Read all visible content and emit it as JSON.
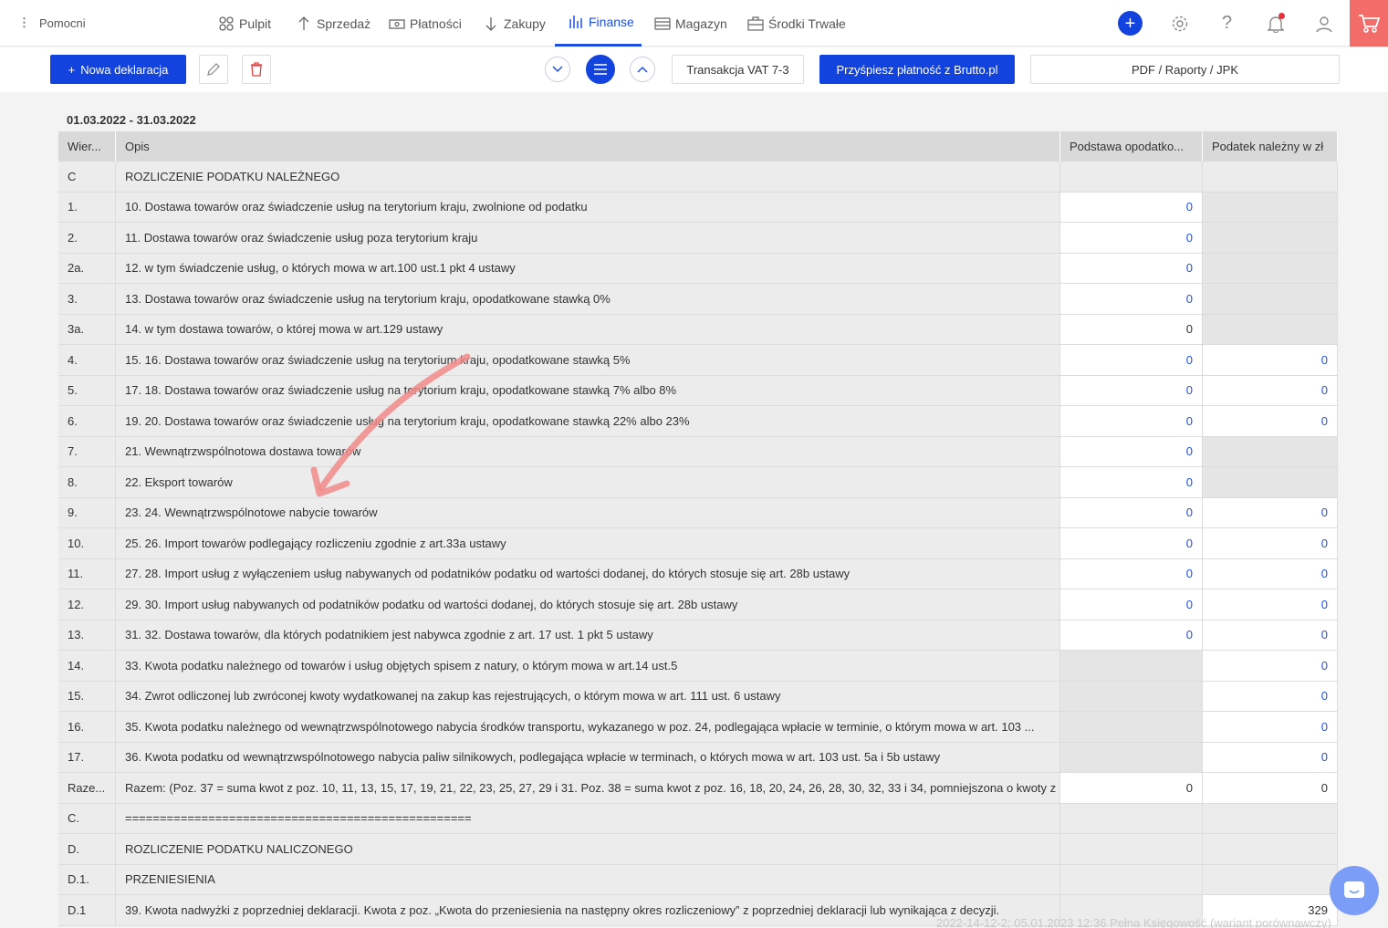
{
  "nav": {
    "helpers": "Pomocni",
    "items": [
      {
        "label": "Pulpit",
        "icon": "dashboard-icon"
      },
      {
        "label": "Sprzedaż",
        "icon": "arrow-up-icon"
      },
      {
        "label": "Płatności",
        "icon": "money-icon"
      },
      {
        "label": "Zakupy",
        "icon": "arrow-down-icon"
      },
      {
        "label": "Finanse",
        "icon": "bar-chart-icon",
        "active": true
      },
      {
        "label": "Magazyn",
        "icon": "warehouse-icon"
      },
      {
        "label": "Środki Trwałe",
        "icon": "briefcase-icon"
      }
    ]
  },
  "toolbar": {
    "new_label": "Nowa deklaracja",
    "vat_label": "Transakcja VAT 7-3",
    "brutto_label": "Przyśpiesz płatność z Brutto.pl",
    "pdf_label": "PDF / Raporty / JPK"
  },
  "period": "01.03.2022 - 31.03.2022",
  "table": {
    "headers": [
      "Wier...",
      "Opis",
      "Podstawa opodatko...",
      "Podatek należny w zł"
    ],
    "rows": [
      {
        "w": "C",
        "opis": "ROZLICZENIE PODATKU NALEŻNEGO",
        "p": "",
        "n": "",
        "pt": "g2",
        "nt": "g2"
      },
      {
        "w": "1.",
        "opis": "10. Dostawa towarów oraz świadczenie usług na terytorium kraju, zwolnione od podatku",
        "p": "0",
        "n": "",
        "pt": "wl",
        "nt": "g"
      },
      {
        "w": "2.",
        "opis": "11. Dostawa towarów oraz świadczenie usług poza terytorium kraju",
        "p": "0",
        "n": "",
        "pt": "wl",
        "nt": "g"
      },
      {
        "w": "2a.",
        "opis": "12. w tym świadczenie usług, o których mowa w art.100 ust.1 pkt 4 ustawy",
        "p": "0",
        "n": "",
        "pt": "wl",
        "nt": "g"
      },
      {
        "w": "3.",
        "opis": "13. Dostawa towarów oraz świadczenie usług na terytorium kraju, opodatkowane stawką 0%",
        "p": "0",
        "n": "",
        "pt": "wl",
        "nt": "g"
      },
      {
        "w": "3a.",
        "opis": "14. w tym dostawa towarów, o której mowa w art.129 ustawy",
        "p": "0",
        "n": "",
        "pt": "wp",
        "nt": "g"
      },
      {
        "w": "4.",
        "opis": "15. 16. Dostawa towarów oraz świadczenie usług na terytorium kraju, opodatkowane stawką 5%",
        "p": "0",
        "n": "0",
        "pt": "wl",
        "nt": "wl"
      },
      {
        "w": "5.",
        "opis": "17. 18. Dostawa towarów oraz świadczenie usług na terytorium kraju, opodatkowane stawką 7% albo 8%",
        "p": "0",
        "n": "0",
        "pt": "wl",
        "nt": "wl"
      },
      {
        "w": "6.",
        "opis": "19. 20. Dostawa towarów oraz świadczenie usług na terytorium kraju, opodatkowane stawką 22% albo 23%",
        "p": "0",
        "n": "0",
        "pt": "wl",
        "nt": "wl"
      },
      {
        "w": "7.",
        "opis": "21. Wewnątrzwspólnotowa dostawa towarów",
        "p": "0",
        "n": "",
        "pt": "wl",
        "nt": "g"
      },
      {
        "w": "8.",
        "opis": "22. Eksport towarów",
        "p": "0",
        "n": "",
        "pt": "wl",
        "nt": "g"
      },
      {
        "w": "9.",
        "opis": "23. 24. Wewnątrzwspólnotowe nabycie towarów",
        "p": "0",
        "n": "0",
        "pt": "wl",
        "nt": "wl"
      },
      {
        "w": "10.",
        "opis": "25. 26. Import towarów podlegający rozliczeniu zgodnie z art.33a ustawy",
        "p": "0",
        "n": "0",
        "pt": "wl",
        "nt": "wl"
      },
      {
        "w": "11.",
        "opis": "27. 28. Import usług z wyłączeniem usług nabywanych od podatników podatku od wartości dodanej, do których stosuje się art. 28b ustawy",
        "p": "0",
        "n": "0",
        "pt": "wl",
        "nt": "wl"
      },
      {
        "w": "12.",
        "opis": "29. 30. Import usług nabywanych od podatników podatku od wartości dodanej, do których stosuje się art. 28b ustawy",
        "p": "0",
        "n": "0",
        "pt": "wl",
        "nt": "wl"
      },
      {
        "w": "13.",
        "opis": "31. 32. Dostawa towarów, dla których podatnikiem jest nabywca zgodnie z art. 17 ust. 1 pkt 5 ustawy",
        "p": "0",
        "n": "0",
        "pt": "wl",
        "nt": "wl"
      },
      {
        "w": "14.",
        "opis": "33. Kwota podatku należnego od towarów i usług objętych spisem z natury, o którym mowa w art.14 ust.5",
        "p": "",
        "n": "0",
        "pt": "g",
        "nt": "wl"
      },
      {
        "w": "15.",
        "opis": "34. Zwrot odliczonej lub zwróconej kwoty wydatkowanej na zakup kas rejestrujących, o którym mowa w art. 111 ust. 6 ustawy",
        "p": "",
        "n": "0",
        "pt": "g",
        "nt": "wl"
      },
      {
        "w": "16.",
        "opis": "35. Kwota podatku należnego od wewnątrzwspólnotowego nabycia środków transportu, wykazanego w poz. 24, podlegająca wpłacie w terminie, o którym mowa w art. 103 ...",
        "p": "",
        "n": "0",
        "pt": "g",
        "nt": "wl"
      },
      {
        "w": "17.",
        "opis": "36. Kwota podatku od wewnątrzwspólnotowego nabycia paliw silnikowych, podlegająca wpłacie w terminach, o których mowa w art. 103 ust. 5a i 5b ustawy",
        "p": "",
        "n": "0",
        "pt": "g",
        "nt": "wl"
      },
      {
        "w": "Raze...",
        "opis": "Razem: (Poz. 37 = suma kwot z poz. 10, 11, 13, 15, 17, 19, 21, 22, 23, 25, 27, 29 i 31. Poz. 38 = suma kwot z poz. 16, 18, 20, 24, 26, 28, 30, 32, 33 i 34, pomniejszona o kwoty z ...",
        "p": "0",
        "n": "0",
        "pt": "wp",
        "nt": "wp"
      },
      {
        "w": "C.",
        "opis": "==================================================",
        "p": "",
        "n": "",
        "pt": "g2",
        "nt": "g2"
      },
      {
        "w": "D.",
        "opis": "ROZLICZENIE PODATKU NALICZONEGO",
        "p": "",
        "n": "",
        "pt": "g2",
        "nt": "g2"
      },
      {
        "w": "D.1.",
        "opis": "PRZENIESIENIA",
        "p": "",
        "n": "",
        "pt": "g2",
        "nt": "g2"
      },
      {
        "w": "D.1",
        "opis": "39. Kwota nadwyżki z poprzedniej deklaracji. Kwota z poz. „Kwota do przeniesienia na następny okres rozliczeniowy” z poprzedniej deklaracji lub wynikająca z decyzji.",
        "p": "",
        "n": "329",
        "pt": "g2",
        "nt": "wp"
      }
    ]
  },
  "footer_ghost": "2022-14-12-2; 05.01.2023 12:36 Pełna Księgowość (wariant porównawczy)",
  "colors": {
    "accent": "#1343df",
    "link": "#1f4fe0",
    "cart": "#f26d6a"
  }
}
